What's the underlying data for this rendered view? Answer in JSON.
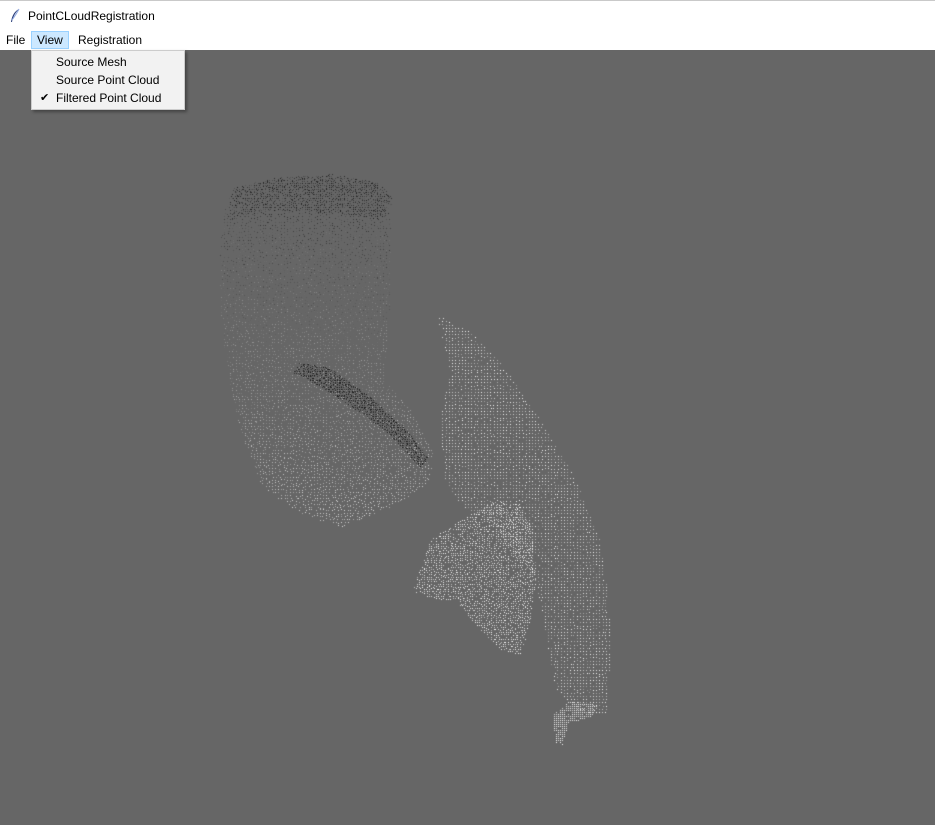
{
  "window": {
    "title": "PointCLoudRegistration",
    "icon": "feather-icon"
  },
  "menubar": {
    "items": [
      {
        "label": "File",
        "active": false
      },
      {
        "label": "View",
        "active": true
      },
      {
        "label": "Registration",
        "active": false
      }
    ]
  },
  "view_menu": {
    "items": [
      {
        "label": "Source Mesh",
        "checked": false,
        "check_mark": ""
      },
      {
        "label": "Source Point Cloud",
        "checked": false,
        "check_mark": ""
      },
      {
        "label": "Filtered Point Cloud",
        "checked": true,
        "check_mark": "✔"
      }
    ]
  },
  "colors": {
    "viewport_background": "#666666",
    "menu_highlight": "#cce8ff",
    "dropdown_background": "#f2f2f2"
  }
}
